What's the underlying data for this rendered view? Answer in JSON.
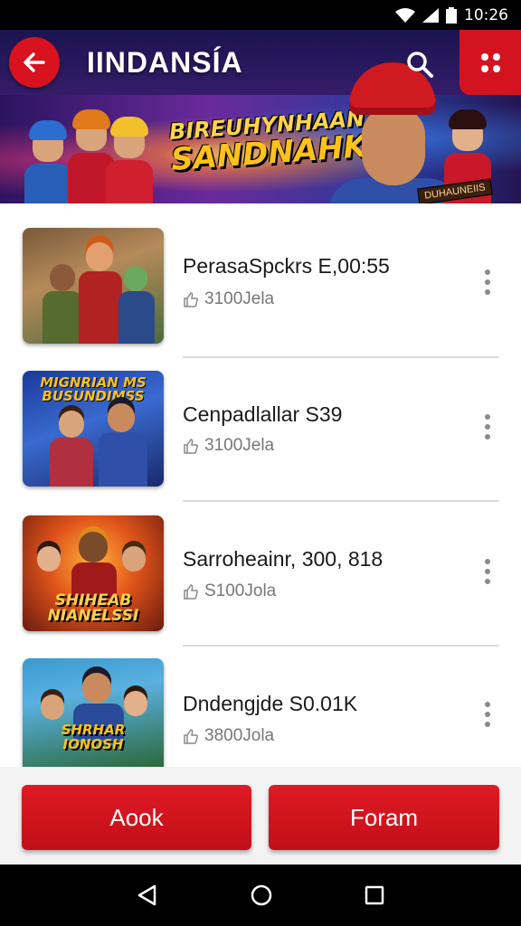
{
  "status_bar": {
    "time": "10:26"
  },
  "header": {
    "title": "IINDANSÍA"
  },
  "banner": {
    "headline_line1": "BIREUHYNHAAN",
    "headline_line2": "SANDNAHKA!",
    "tag": "DUHAUNEIIS"
  },
  "thumbnails": [
    {
      "text": ""
    },
    {
      "text": "MIGNRIAN​ MS BUSUNDIMSS"
    },
    {
      "text": "SHIHEAB NIANELSSI"
    },
    {
      "text": "SHRHAR IONOSH"
    }
  ],
  "items": [
    {
      "title": "PerasaSpckrs E,00:55",
      "meta": "3100Jela"
    },
    {
      "title": "Cenpadlallar S39",
      "meta": "3100Jela"
    },
    {
      "title": "Sarroheainr, 300, 818",
      "meta": "S100Jola"
    },
    {
      "title": "Dndengjde S0.01K",
      "meta": "3800Jola"
    }
  ],
  "actions": {
    "left_label": "Aook",
    "right_label": "Foram"
  },
  "colors": {
    "accent": "#d31420",
    "banner_bg": "#2c1460",
    "divider": "#dcdcdc"
  },
  "icons": [
    "back-arrow-icon",
    "search-icon",
    "grid-menu-icon",
    "thumbs-up-icon",
    "more-vert-icon",
    "nav-back-icon",
    "nav-home-icon",
    "nav-recents-icon"
  ]
}
